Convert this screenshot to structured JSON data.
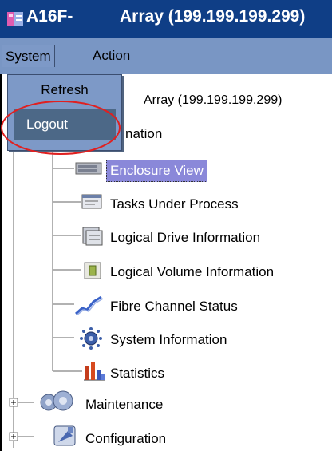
{
  "title_bar": {
    "app_name": "A16F-",
    "window_title": "Array (199.199.199.299)"
  },
  "menu_bar": {
    "items": [
      {
        "label": "System"
      },
      {
        "label": "Action"
      }
    ]
  },
  "system_menu": {
    "items": [
      {
        "label": "Refresh"
      },
      {
        "label": "Logout"
      }
    ]
  },
  "tree": {
    "root": "Array (199.199.199.299)",
    "information_partial": "nation",
    "children": [
      {
        "label": "Enclosure View",
        "icon": "enclosure-icon",
        "selected": true
      },
      {
        "label": "Tasks Under Process",
        "icon": "tasks-icon"
      },
      {
        "label": "Logical Drive Information",
        "icon": "logical-drive-icon"
      },
      {
        "label": "Logical Volume Information",
        "icon": "logical-volume-icon"
      },
      {
        "label": "Fibre Channel Status",
        "icon": "fibre-channel-icon"
      },
      {
        "label": "System Information",
        "icon": "system-info-icon"
      },
      {
        "label": "Statistics",
        "icon": "statistics-icon"
      }
    ],
    "collapsed": [
      {
        "label": "Maintenance",
        "icon": "maintenance-icon"
      },
      {
        "label": "Configuration",
        "icon": "configuration-icon"
      }
    ]
  },
  "colors": {
    "title_bar": "#0f3e86",
    "menu_bar": "#7996c4",
    "menu_highlight": "#4c6887",
    "selection": "#8a88d9",
    "annotation": "#e02020"
  }
}
